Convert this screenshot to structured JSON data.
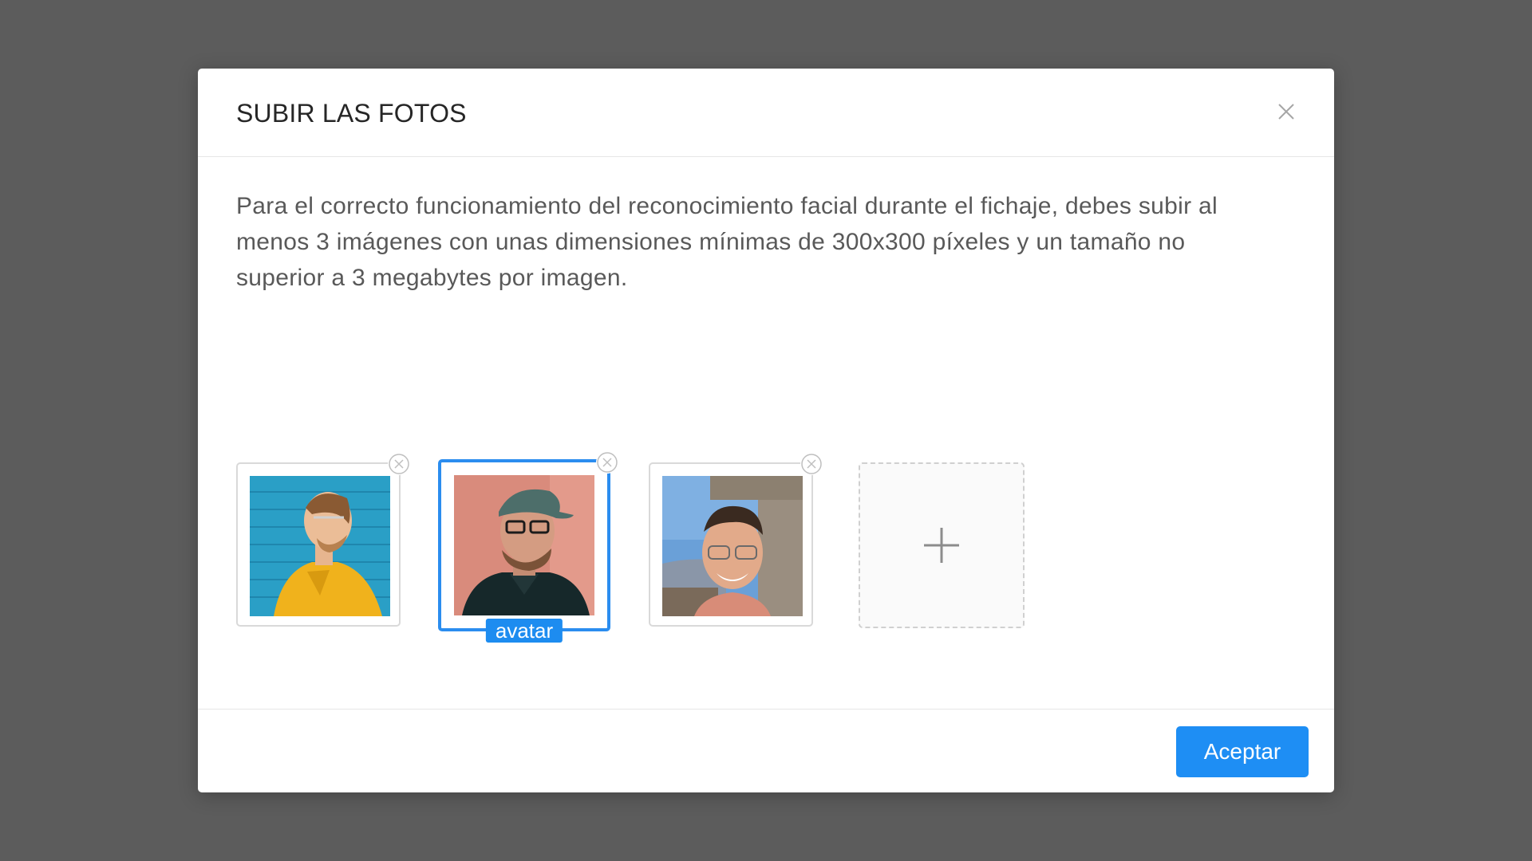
{
  "modal": {
    "title": "SUBIR LAS FOTOS",
    "close_icon": "close-icon",
    "description": "Para el correcto funcionamiento del reconocimiento facial durante el fichaje, debes subir al menos 3 imágenes con unas dimensiones mínimas de 300x300 píxeles y un tamaño no superior a 3 megabytes por imagen.",
    "photos": [
      {
        "subject": "man in yellow jacket against blue brick wall",
        "selected": false,
        "remove_icon": "remove-circle-icon"
      },
      {
        "subject": "man with cap and glasses against pink wall",
        "selected": true,
        "badge": "avatar",
        "remove_icon": "remove-circle-icon"
      },
      {
        "subject": "smiling man with glasses outdoors",
        "selected": false,
        "remove_icon": "remove-circle-icon"
      }
    ],
    "add_icon": "plus-icon",
    "accept_label": "Aceptar"
  },
  "colors": {
    "overlay": "#5c5c5c",
    "accent": "#1e8ef4",
    "selected_border": "#2b8def",
    "title_text": "#262626",
    "body_text": "#595959"
  }
}
